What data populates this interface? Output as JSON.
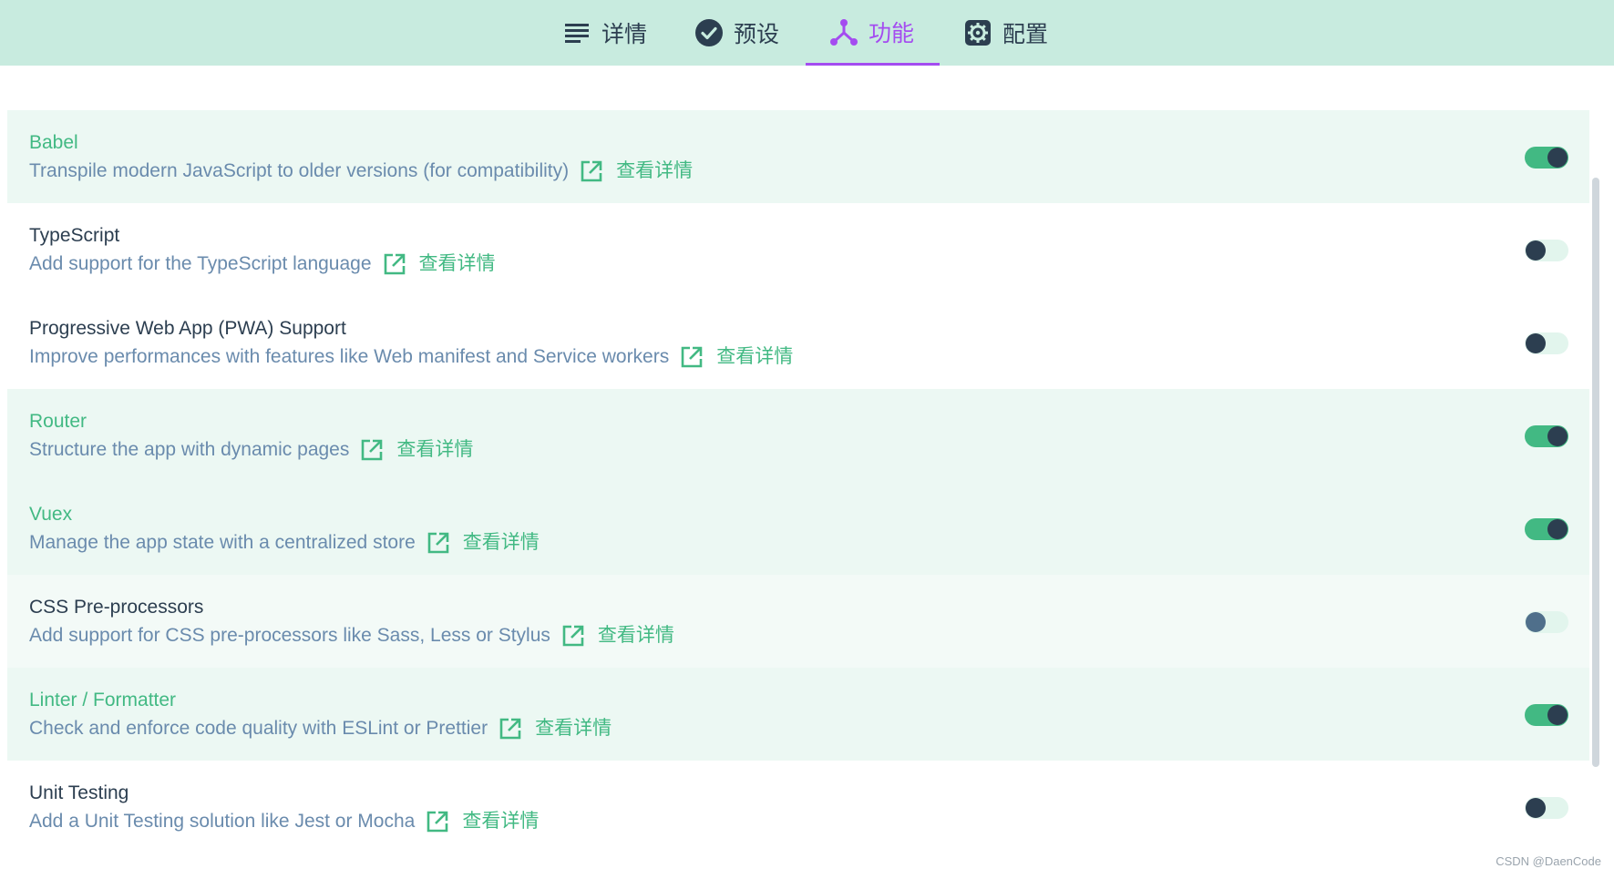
{
  "tabs": [
    {
      "label": "详情",
      "icon": "list-icon",
      "active": false
    },
    {
      "label": "预设",
      "icon": "check-circle-icon",
      "active": false
    },
    {
      "label": "功能",
      "icon": "branch-icon",
      "active": true
    },
    {
      "label": "配置",
      "icon": "gear-icon",
      "active": false
    }
  ],
  "features": [
    {
      "title": "Babel",
      "description": "Transpile modern JavaScript to older versions (for compatibility)",
      "link": "查看详情",
      "enabled": true
    },
    {
      "title": "TypeScript",
      "description": "Add support for the TypeScript language",
      "link": "查看详情",
      "enabled": false
    },
    {
      "title": "Progressive Web App (PWA) Support",
      "description": "Improve performances with features like Web manifest and Service workers",
      "link": "查看详情",
      "enabled": false
    },
    {
      "title": "Router",
      "description": "Structure the app with dynamic pages",
      "link": "查看详情",
      "enabled": true
    },
    {
      "title": "Vuex",
      "description": "Manage the app state with a centralized store",
      "link": "查看详情",
      "enabled": true
    },
    {
      "title": "CSS Pre-processors",
      "description": "Add support for CSS pre-processors like Sass, Less or Stylus",
      "link": "查看详情",
      "enabled": false
    },
    {
      "title": "Linter / Formatter",
      "description": "Check and enforce code quality with ESLint or Prettier",
      "link": "查看详情",
      "enabled": true
    },
    {
      "title": "Unit Testing",
      "description": "Add a Unit Testing solution like Jest or Mocha",
      "link": "查看详情",
      "enabled": false
    }
  ],
  "watermark": "CSDN @DaenCode",
  "colors": {
    "accent": "#42b983",
    "active_tab": "#a44cf0",
    "topbar": "#c8ebdf",
    "text": "#2c3e50",
    "description": "#6a8bad"
  }
}
